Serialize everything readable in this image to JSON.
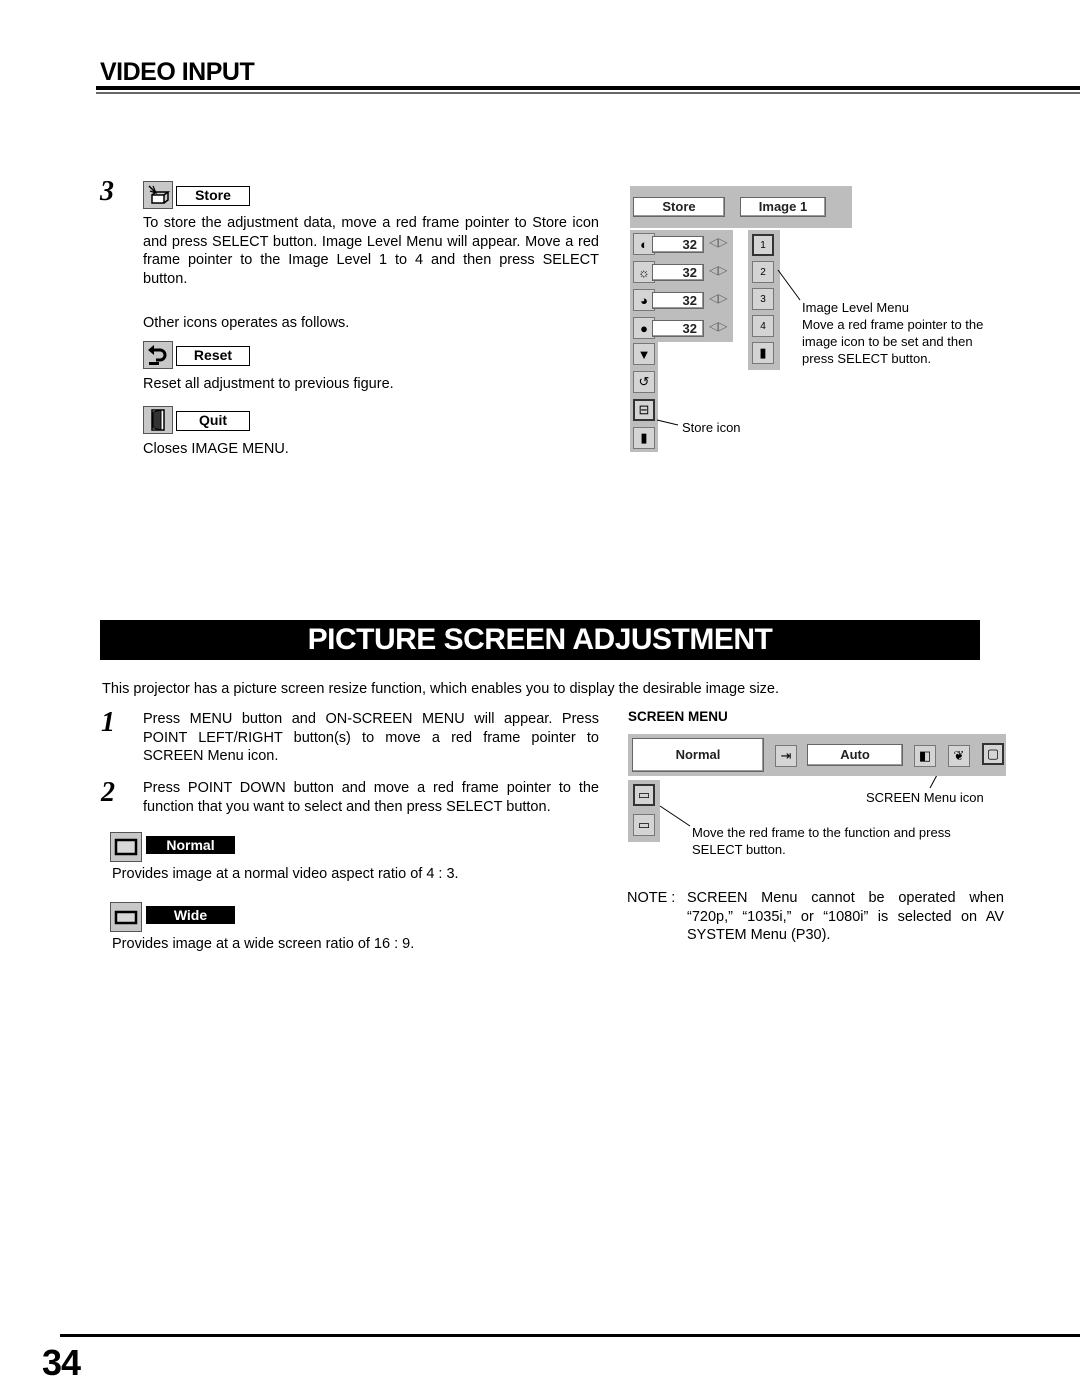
{
  "header": {
    "section_title": "VIDEO INPUT"
  },
  "store_section": {
    "step_number": "3",
    "store_label": "Store",
    "store_text": "To store the adjustment data, move a red frame pointer to Store icon and press SELECT button.  Image Level Menu will appear. Move a red frame pointer to the Image Level 1 to 4 and then press SELECT button.",
    "other_icons_text": "Other icons operates as follows.",
    "reset_label": "Reset",
    "reset_text": "Reset all adjustment to previous figure.",
    "quit_label": "Quit",
    "quit_text": "Closes IMAGE MENU."
  },
  "image_menu_osd": {
    "store_field": "Store",
    "image_field": "Image 1",
    "rows": [
      {
        "icon": "contrast-icon",
        "value": "32"
      },
      {
        "icon": "brightness-icon",
        "value": "32"
      },
      {
        "icon": "color-icon",
        "value": "32"
      },
      {
        "icon": "tint-icon",
        "value": "32"
      }
    ],
    "level_items": [
      "1",
      "2",
      "3",
      "4"
    ],
    "image_level_caption_title": "Image Level Menu",
    "image_level_caption_body": "Move a red frame pointer to the image icon to be set and then press SELECT button.",
    "store_icon_caption": "Store icon"
  },
  "picture_screen": {
    "banner_title": "PICTURE SCREEN ADJUSTMENT",
    "intro": "This projector has a picture screen resize function, which enables you to display the desirable image size.",
    "steps": [
      {
        "number": "1",
        "text": "Press MENU button and ON-SCREEN MENU will appear.  Press POINT LEFT/RIGHT button(s) to move a red frame pointer to SCREEN Menu icon."
      },
      {
        "number": "2",
        "text": "Press POINT DOWN button and move a red frame pointer to the function that you want to select and then press SELECT button."
      }
    ],
    "normal_label": "Normal",
    "normal_text": "Provides image at a normal video aspect ratio of 4 : 3.",
    "wide_label": "Wide",
    "wide_text": "Provides image at a wide screen ratio of 16 : 9."
  },
  "screen_menu_osd": {
    "heading": "SCREEN MENU",
    "mode_field": "Normal",
    "auto_field": "Auto",
    "screen_icon_caption": "SCREEN Menu icon",
    "function_caption": "Move the red frame to the function and press SELECT button."
  },
  "note": {
    "prefix": "NOTE :",
    "text": "SCREEN Menu cannot be operated when “720p,” “1035i,” or “1080i” is selected on AV SYSTEM Menu (P30)."
  },
  "footer": {
    "page_number": "34"
  }
}
